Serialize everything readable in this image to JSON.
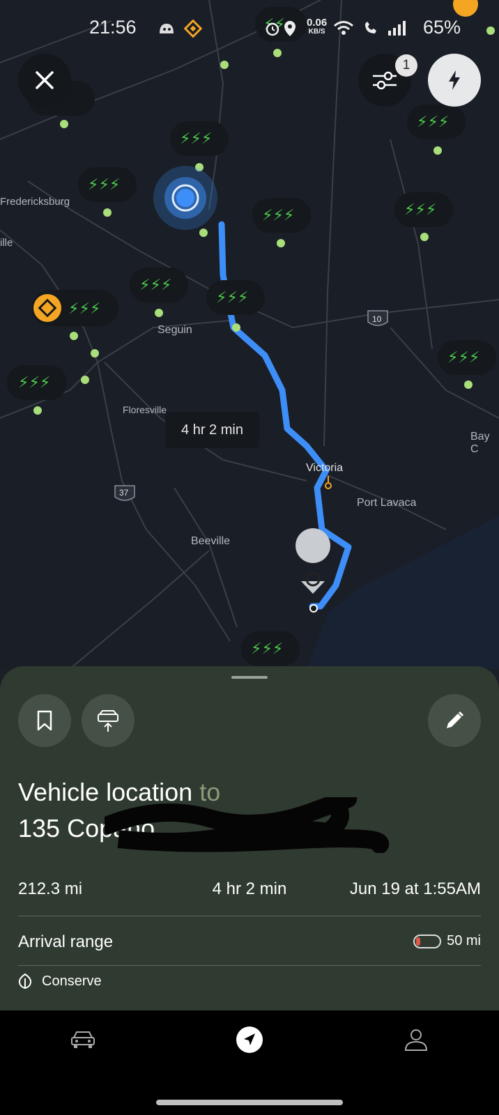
{
  "status_bar": {
    "time": "21:56",
    "speed_value": "0.06",
    "speed_unit": "KB/S",
    "battery": "65%"
  },
  "map": {
    "filter_count": "1",
    "labels": {
      "fredericksburg": "Fredericksburg",
      "ille": "ille",
      "seguin": "Seguin",
      "floresville": "Floresville",
      "victoria": "Victoria",
      "port_lavaca": "Port Lavaca",
      "beeville": "Beeville",
      "bay_c": "Bay C",
      "interstate_10": "10",
      "interstate_37": "37"
    },
    "route_eta": "4 hr 2 min",
    "colors": {
      "route": "#3d8ef7",
      "charger_bolt": "#4cc94b",
      "charger_dot": "#a9de7b",
      "supercharger": "#f4a623"
    }
  },
  "route": {
    "origin": "Vehicle location",
    "connector": "to",
    "destination": "135 Copano",
    "distance": "212.3 mi",
    "duration": "4 hr 2 min",
    "arrival": "Jun 19 at 1:55AM",
    "arrival_range_label": "Arrival range",
    "arrival_range_value": "50 mi",
    "mode": "Conserve"
  }
}
